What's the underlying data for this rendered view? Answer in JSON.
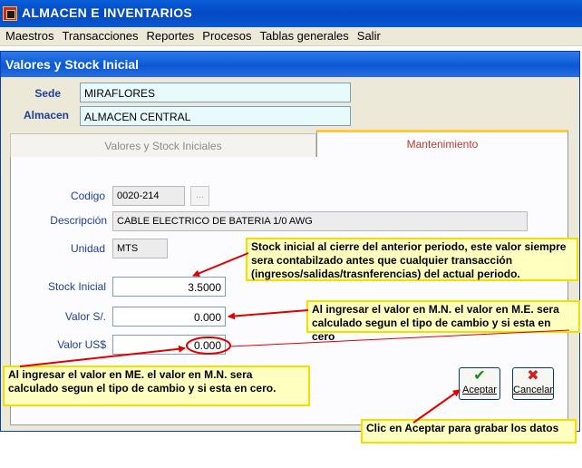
{
  "app": {
    "title": "ALMACEN E INVENTARIOS"
  },
  "menu": [
    "Maestros",
    "Transacciones",
    "Reportes",
    "Procesos",
    "Tablas generales",
    "Salir"
  ],
  "window": {
    "title": "Valores y Stock Inicial"
  },
  "header": {
    "sede_label": "Sede",
    "sede_value": "MIRAFLORES",
    "almacen_label": "Almacen",
    "almacen_value": "ALMACEN CENTRAL"
  },
  "tabs": [
    {
      "label": "Valores y Stock Iniciales",
      "active": false
    },
    {
      "label": "Mantenimiento",
      "active": true
    }
  ],
  "form": {
    "codigo_label": "Codigo",
    "codigo_value": "0020-214",
    "lookup_label": "...",
    "descripcion_label": "Descripción",
    "descripcion_value": "CABLE ELECTRICO DE BATERIA 1/0 AWG",
    "unidad_label": "Unidad",
    "unidad_value": "MTS",
    "stock_label": "Stock Inicial",
    "stock_value": "3.5000",
    "valor_sol_label": "Valor S/.",
    "valor_sol_value": "0.000",
    "valor_usd_label": "Valor US$",
    "valor_usd_value": "0.000"
  },
  "buttons": {
    "accept": "Aceptar",
    "cancel": "Cancelar"
  },
  "annotations": {
    "stock": "Stock inicial al cierre del anterior periodo, este valor siempre sera contabilzado antes  que cualquier transacción (ingresos/salidas/trasnferencias) del actual periodo.",
    "mn": "Al ingresar el valor en M.N. el valor en M.E. sera calculado segun el tipo de cambio y si esta en cero",
    "me": "Al ingresar el valor en ME. el valor en M.N. sera calculado segun el tipo de cambio y si esta en cero.",
    "accept": "Clic en Aceptar para grabar los datos"
  },
  "colors": {
    "titlebar": "#0348c4",
    "window_bg": "#ece9d8",
    "field_bg": "#e7fbfd",
    "label": "#1f3f97",
    "note_bg": "#ffffc0",
    "note_border": "#f0e000",
    "arrow": "#e00000",
    "active_tab_text": "#c0392b"
  },
  "icons": {
    "app": "app-icon",
    "accept": "check-icon",
    "cancel": "x-icon"
  }
}
